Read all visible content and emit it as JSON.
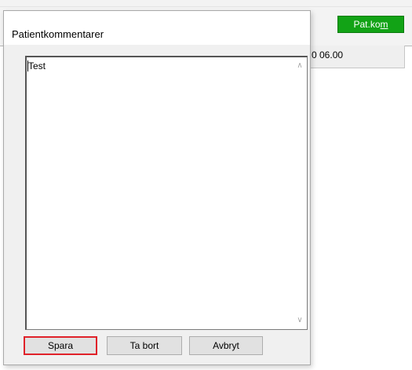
{
  "background_window": {
    "patkom_label_prefix": "Pat.ko",
    "patkom_label_underlined": "m",
    "time_value": "0 06.00",
    "patkom_color": "#12a316"
  },
  "dialog": {
    "title": "Patientkommentarer",
    "comment_value": "Test",
    "scroll_up_icon": "chevron-up",
    "scroll_down_icon": "chevron-down",
    "buttons": {
      "save": "Spara",
      "delete": "Ta bort",
      "cancel": "Avbryt"
    },
    "focus_color": "#e0222a"
  }
}
